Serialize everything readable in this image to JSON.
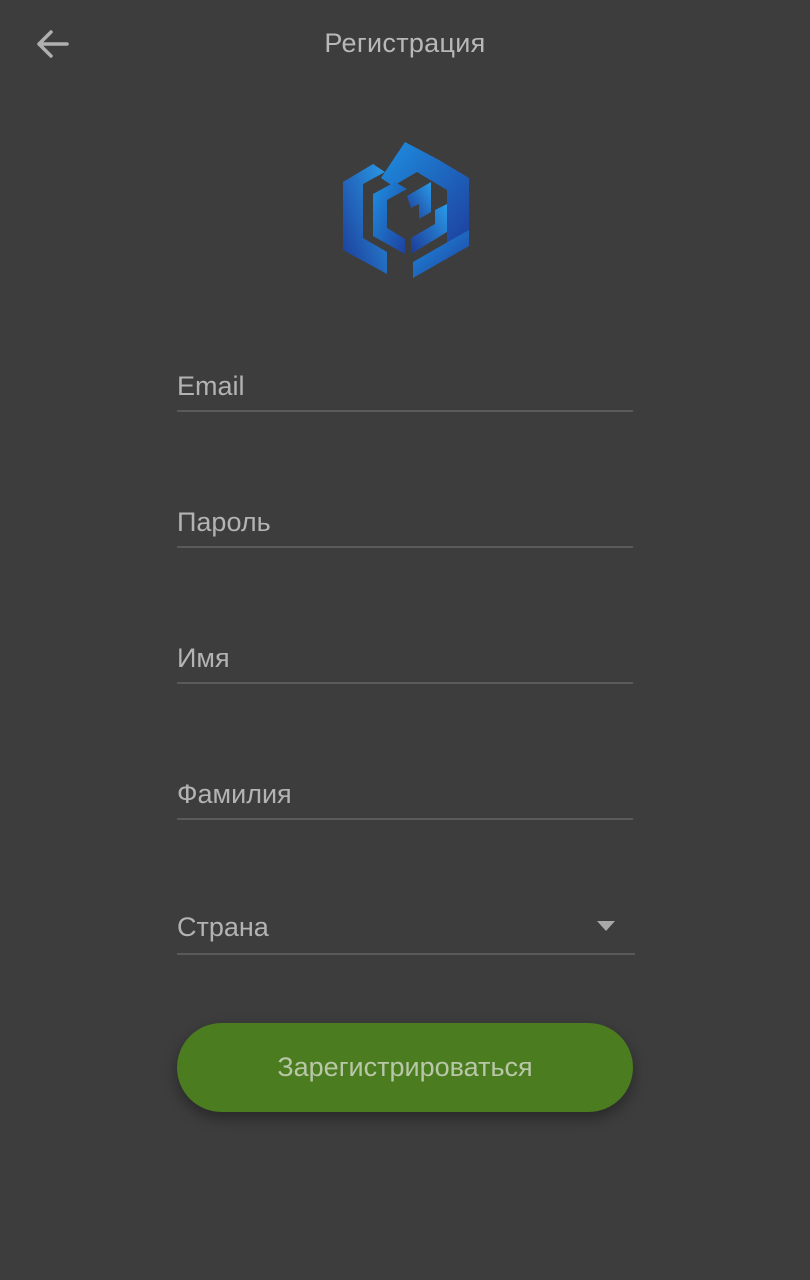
{
  "header": {
    "title": "Регистрация",
    "back_icon": "arrow-left-icon"
  },
  "logo": {
    "icon": "hexagon-logo-icon",
    "colors": [
      "#1e8fe0",
      "#1e3f9e"
    ]
  },
  "form": {
    "email_placeholder": "Email",
    "password_placeholder": "Пароль",
    "first_name_placeholder": "Имя",
    "last_name_placeholder": "Фамилия",
    "country": {
      "label": "Страна",
      "caret_icon": "dropdown-caret-icon"
    },
    "submit_label": "Зарегистрироваться"
  },
  "colors": {
    "background": "#3d3d3d",
    "accent": "#4b7c1f"
  }
}
